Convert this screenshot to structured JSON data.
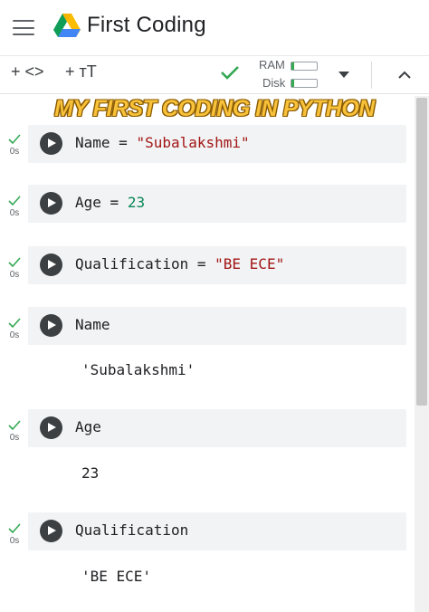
{
  "app": {
    "title": "First Coding"
  },
  "toolbar": {
    "add_code_label": "+ <>",
    "add_text_label": "+ тT",
    "ram_label": "RAM",
    "disk_label": "Disk"
  },
  "banner": {
    "text": "MY FIRST CODING IN PYTHON"
  },
  "cells": [
    {
      "status": "0s",
      "var": "Name",
      "op": " = ",
      "value": "\"Subalakshmi\"",
      "output": ""
    },
    {
      "status": "0s",
      "var": "Age",
      "op": " = ",
      "value": "23",
      "output": ""
    },
    {
      "status": "0s",
      "var": "Qualification",
      "op": " = ",
      "value": "\"BE ECE\"",
      "output": ""
    },
    {
      "status": "0s",
      "var": "Name",
      "op": "",
      "value": "",
      "output": "'Subalakshmi'"
    },
    {
      "status": "0s",
      "var": "Age",
      "op": "",
      "value": "",
      "output": "23"
    },
    {
      "status": "0s",
      "var": "Qualification",
      "op": "",
      "value": "",
      "output": "'BE ECE'"
    }
  ],
  "colors": {
    "check": "#34a853",
    "string": "#a31515",
    "number": "#098658"
  }
}
